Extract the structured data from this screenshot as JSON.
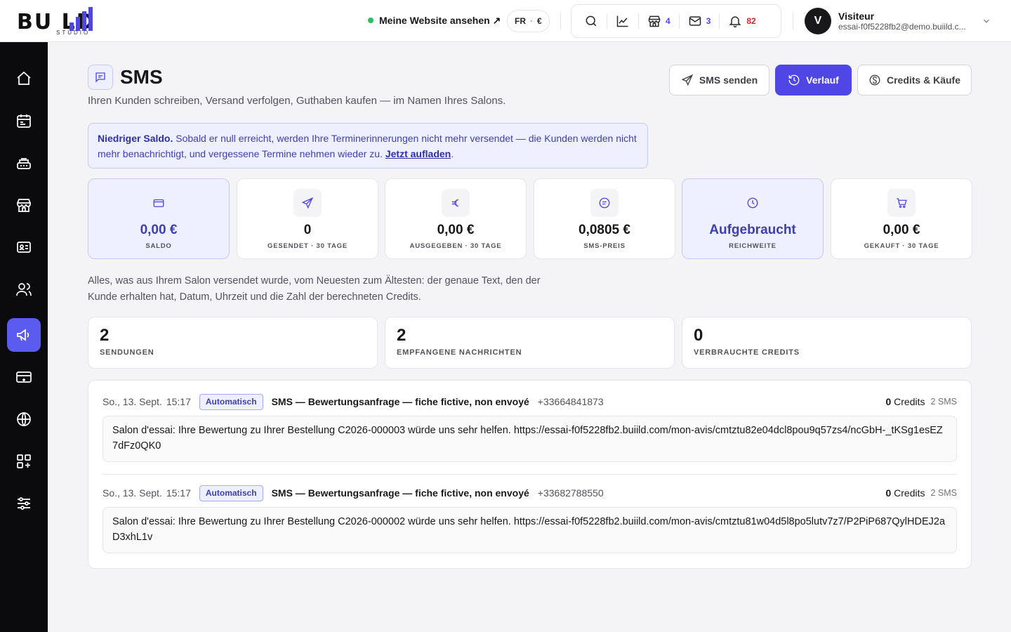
{
  "brand": {
    "logo_text": "BU  LD",
    "logo_sub": "STUDIO"
  },
  "header": {
    "site_link": "Meine Website ansehen ↗",
    "lang": "FR",
    "currency": "€",
    "tools": {
      "shops_count": "4",
      "mail_count": "3",
      "notifications_count": "82"
    },
    "user": {
      "initial": "V",
      "name": "Visiteur",
      "email": "essai-f0f5228fb2@demo.buiild.c..."
    }
  },
  "sidebar": {
    "items": [
      {
        "icon": "home-icon"
      },
      {
        "icon": "calendar-icon"
      },
      {
        "icon": "register-icon"
      },
      {
        "icon": "store-icon"
      },
      {
        "icon": "contact-card-icon"
      },
      {
        "icon": "users-icon"
      },
      {
        "icon": "megaphone-icon",
        "active": true
      },
      {
        "icon": "credit-card-icon"
      },
      {
        "icon": "globe-icon"
      },
      {
        "icon": "apps-icon"
      },
      {
        "icon": "sliders-icon"
      }
    ]
  },
  "page": {
    "title": "SMS",
    "subtitle": "Ihren Kunden schreiben, Versand verfolgen, Guthaben kaufen — im Namen Ihres Salons.",
    "buttons": {
      "send": "SMS senden",
      "history": "Verlauf",
      "credits": "Credits & Käufe"
    },
    "alert": {
      "strong": "Niedriger Saldo.",
      "text": " Sobald er null erreicht, werden Ihre Terminerinnerungen nicht mehr versendet — die Kunden werden nicht mehr benachrichtigt, und vergessene Termine nehmen wieder zu. ",
      "link": "Jetzt aufladen",
      "end": "."
    },
    "stats": [
      {
        "value": "0,00 €",
        "label": "SALDO",
        "icon": "wallet-icon",
        "highlight": true
      },
      {
        "value": "0",
        "label": "GESENDET · 30 TAGE",
        "icon": "send-icon"
      },
      {
        "value": "0,00 €",
        "label": "AUSGEGEBEN · 30 TAGE",
        "icon": "euro-icon"
      },
      {
        "value": "0,0805 €",
        "label": "SMS-PREIS",
        "icon": "message-icon"
      },
      {
        "value": "Aufgebraucht",
        "label": "REICHWEITE",
        "icon": "clock-icon",
        "highlight": true
      },
      {
        "value": "0,00 €",
        "label": "GEKAUFT · 30 TAGE",
        "icon": "cart-icon"
      }
    ],
    "description": "Alles, was aus Ihrem Salon versendet wurde, vom Neuesten zum Ältesten: der genaue Text, den der Kunde erhalten hat, Datum, Uhrzeit und die Zahl der berechneten Credits.",
    "summary": [
      {
        "value": "2",
        "label": "SENDUNGEN"
      },
      {
        "value": "2",
        "label": "EMPFANGENE NACHRICHTEN"
      },
      {
        "value": "0",
        "label": "VERBRAUCHTE CREDITS"
      }
    ],
    "log": [
      {
        "date": "So., 13. Sept.",
        "time": "15:17",
        "badge": "Automatisch",
        "title": "SMS — Bewertungsanfrage — fiche fictive, non envoyé",
        "phone": "+33664841873",
        "credits_num": "0",
        "credits_word": " Credits",
        "sms": "2 SMS",
        "message": "Salon d'essai: Ihre Bewertung zu Ihrer Bestellung C2026-000003 würde uns sehr helfen. https://essai-f0f5228fb2.buiild.com/mon-avis/cmtztu82e04dcl8pou9q57zs4/ncGbH-_tKSg1esEZ7dFz0QK0"
      },
      {
        "date": "So., 13. Sept.",
        "time": "15:17",
        "badge": "Automatisch",
        "title": "SMS — Bewertungsanfrage — fiche fictive, non envoyé",
        "phone": "+33682788550",
        "credits_num": "0",
        "credits_word": " Credits",
        "sms": "2 SMS",
        "message": "Salon d'essai: Ihre Bewertung zu Ihrer Bestellung C2026-000002 würde uns sehr helfen. https://essai-f0f5228fb2.buiild.com/mon-avis/cmtztu81w04d5l8po5lutv7z7/P2PiP687QylHDEJ2aD3xhL1v"
      }
    ]
  },
  "colors": {
    "accent": "#4f46e5",
    "accent_light": "#eef0ff",
    "sidebar_bg": "#0b0b0d",
    "success": "#22c55e",
    "danger": "#dc2626"
  }
}
